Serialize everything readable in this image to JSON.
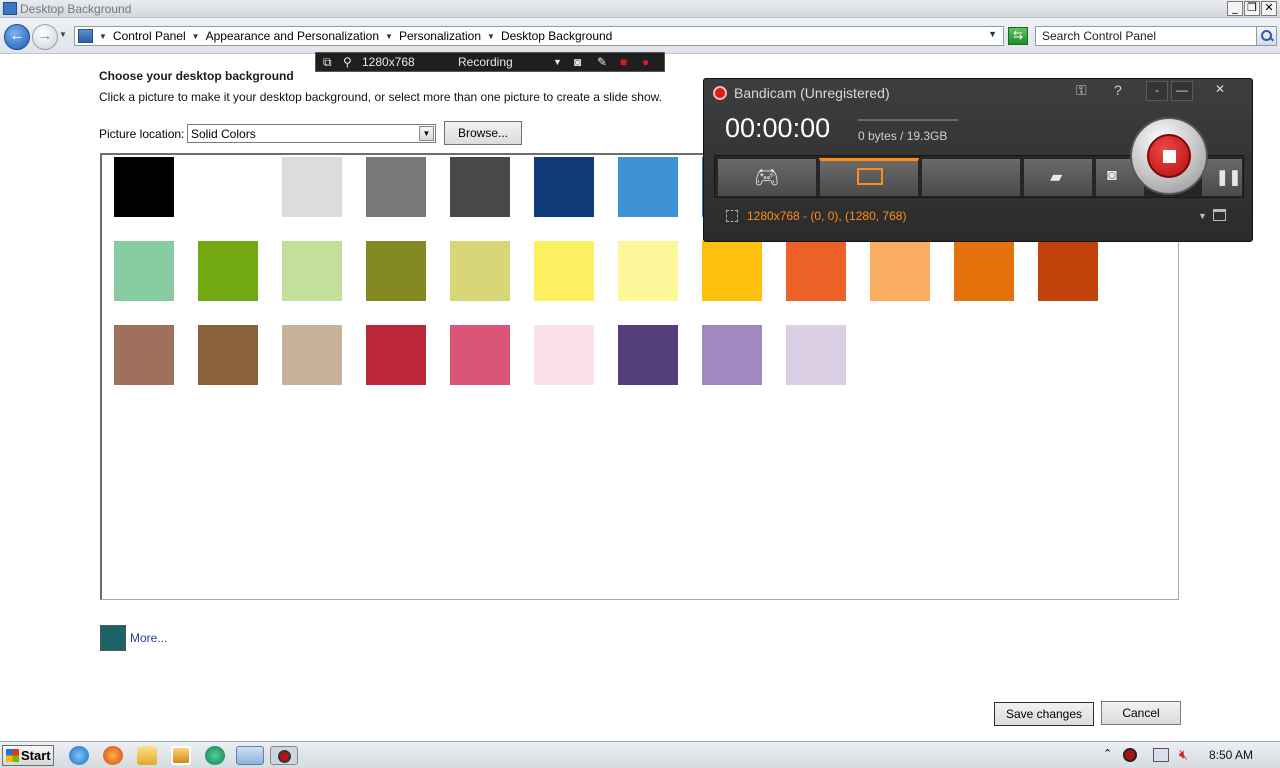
{
  "window": {
    "title": "Desktop Background",
    "controls": {
      "minimize": "_",
      "restore": "❐",
      "close": "✕"
    }
  },
  "address_bar": {
    "breadcrumbs": [
      "Control Panel",
      "Appearance and Personalization",
      "Personalization",
      "Desktop Background"
    ],
    "search_placeholder": "Search Control Panel"
  },
  "content": {
    "heading": "Choose your desktop background",
    "subtext": "Click a picture to make it your desktop background, or select more than one picture to create a slide show.",
    "picture_location_label": "Picture location:",
    "picture_location_value": "Solid Colors",
    "browse_label": "Browse...",
    "swatch_rows": [
      [
        "#000000",
        "#ffffff",
        "#dcdcdc",
        "#787878",
        "#484848",
        "#0f3b78",
        "#3f93d3",
        "#3e80c6",
        "#2a6fb6",
        "#1d5aa4",
        "#143f87",
        "#0c2f6c"
      ],
      [
        "#86cca0",
        "#72a812",
        "#c3e09b",
        "#838820",
        "#d8d679",
        "#fcef60",
        "#fdf79a",
        "#fec00f",
        "#eb6126",
        "#f9ad60",
        "#e4710c",
        "#c1420a"
      ],
      [
        "#a0715a",
        "#8b613a",
        "#c5b299",
        "#bc2839",
        "#da5575",
        "#fde1ea",
        "#533e7a",
        "#a088c0",
        "#dbcfe5"
      ]
    ],
    "more_label": "More...",
    "more_color": "#1e6467",
    "save_label": "Save changes",
    "cancel_label": "Cancel"
  },
  "recording_toolbar": {
    "resolution": "1280x768",
    "status": "Recording"
  },
  "bandicam": {
    "title": "Bandicam (Unregistered)",
    "timer": "00:00:00",
    "size": "0 bytes / 19.3GB",
    "region_status": "1280x768 - (0, 0), (1280, 768)",
    "help": "?",
    "minimize": "-",
    "close": "✕",
    "accent": "#ff8c1a"
  },
  "taskbar": {
    "start_label": "Start",
    "clock": "8:50 AM"
  }
}
